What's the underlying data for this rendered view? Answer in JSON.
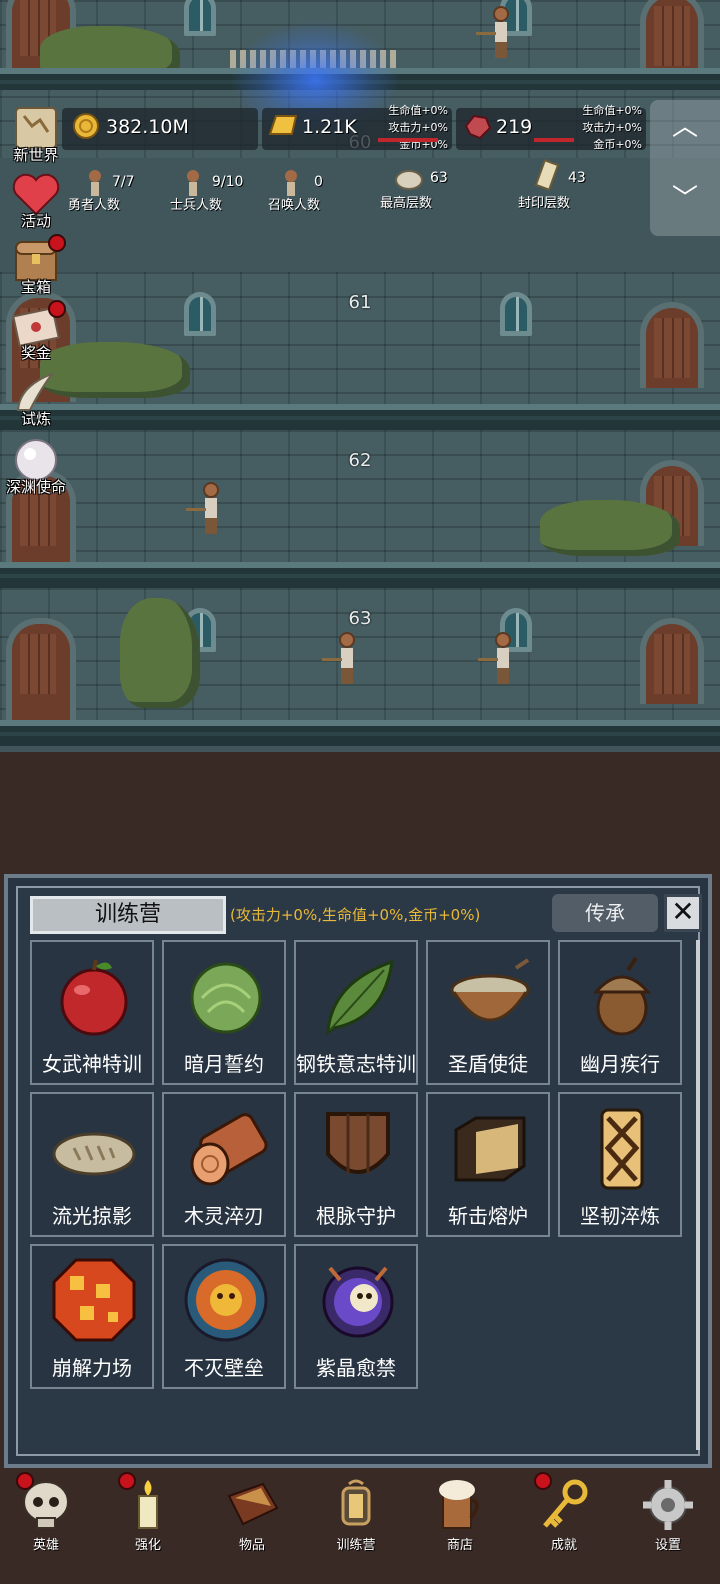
{
  "floors": [
    {
      "number": "60"
    },
    {
      "number": "61"
    },
    {
      "number": "62"
    },
    {
      "number": "63"
    }
  ],
  "sidebar": {
    "items": [
      {
        "label": "新世界",
        "icon": "map-icon",
        "badge": false
      },
      {
        "label": "活动",
        "icon": "heart-icon",
        "badge": false
      },
      {
        "label": "宝箱",
        "icon": "chest-icon",
        "badge": true
      },
      {
        "label": "奖金",
        "icon": "envelope-icon",
        "badge": true
      },
      {
        "label": "试炼",
        "icon": "horn-icon",
        "badge": false
      },
      {
        "label": "深渊使命",
        "icon": "pearl-icon",
        "badge": false
      }
    ]
  },
  "resources": {
    "gold": "382.10M",
    "gold_bar": "1.21K",
    "gem": "219",
    "buffs_left": [
      "生命值+0%",
      "攻击力+0%",
      "金币+0%"
    ],
    "buffs_right": [
      "生命值+0%",
      "攻击力+0%",
      "金币+0%"
    ]
  },
  "stats": {
    "heroes": {
      "value": "7/7",
      "label": "勇者人数"
    },
    "soldiers": {
      "value": "9/10",
      "label": "士兵人数"
    },
    "summons": {
      "value": "0",
      "label": "召唤人数"
    },
    "max_floor": {
      "value": "63",
      "label": "最高层数"
    },
    "sealed_floor": {
      "value": "43",
      "label": "封印层数"
    }
  },
  "panel": {
    "title": "训练营",
    "bonus": "(攻击力+0%,生命值+0%,金币+0%)",
    "inherit_label": "传承",
    "close_icon": "close-icon",
    "items": [
      {
        "name": "女武神特训",
        "icon": "apple-icon"
      },
      {
        "name": "暗月誓约",
        "icon": "cabbage-icon"
      },
      {
        "name": "钢铁意志特训",
        "icon": "leaf-icon"
      },
      {
        "name": "圣盾使徒",
        "icon": "bowl-icon"
      },
      {
        "name": "幽月疾行",
        "icon": "acorn-icon"
      },
      {
        "name": "流光掠影",
        "icon": "bread-icon"
      },
      {
        "name": "木灵淬刃",
        "icon": "log-icon"
      },
      {
        "name": "根脉守护",
        "icon": "wood-shield-icon"
      },
      {
        "name": "斩击熔炉",
        "icon": "cube-icon"
      },
      {
        "name": "坚韧淬炼",
        "icon": "board-shield-icon"
      },
      {
        "name": "崩解力场",
        "icon": "lava-orb-icon"
      },
      {
        "name": "不灭壁垒",
        "icon": "sun-shield-icon"
      },
      {
        "name": "紫晶愈禁",
        "icon": "crystal-skull-icon"
      }
    ]
  },
  "nav": {
    "items": [
      {
        "label": "英雄",
        "icon": "skull-icon",
        "badge": true
      },
      {
        "label": "强化",
        "icon": "candle-icon",
        "badge": true
      },
      {
        "label": "物品",
        "icon": "book-icon",
        "badge": false
      },
      {
        "label": "训练营",
        "icon": "lantern-icon",
        "badge": false
      },
      {
        "label": "商店",
        "icon": "mug-icon",
        "badge": false
      },
      {
        "label": "成就",
        "icon": "key-icon",
        "badge": true
      },
      {
        "label": "设置",
        "icon": "gear-icon",
        "badge": false
      }
    ]
  },
  "colors": {
    "panel_bg": "#283442",
    "bonus_text": "#e8b838",
    "badge_red": "#c8121c"
  }
}
